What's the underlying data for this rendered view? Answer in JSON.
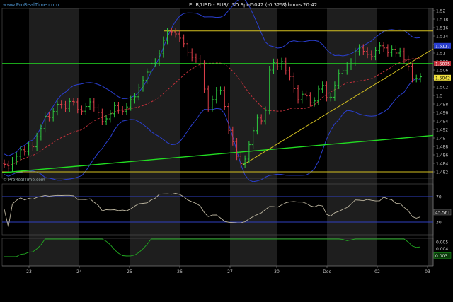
{
  "header": {
    "watermark": "www.ProRealTime.com",
    "title": "EUR/USD - EUR/USD Spot",
    "last": "1.5042 (-0.32%)",
    "period": "2 hours",
    "time": "20:42",
    "sub_watermark": "© ProRealTime.com"
  },
  "colors": {
    "background": "#000000",
    "shade": "#1e1e1e",
    "bullish": "#2ecc40",
    "bearish": "#e0404a",
    "bollinger": "#2a3fd0",
    "moving_average": "#c0303a",
    "support": "#22dd22",
    "trendline": "#d4c020",
    "rsi": "#bdb6a0",
    "momentum": "#22aa22",
    "levels": "#3040c0",
    "axis_text": "#c8c8c8"
  },
  "chart_data": [
    {
      "type": "candlestick",
      "title": "EUR/USD - EUR/USD Spot",
      "x_ticks": [
        "23",
        "24",
        "25",
        "26",
        "27",
        "30",
        "Dec",
        "02",
        "03"
      ],
      "y_ticks": [
        "1.482",
        "1.484",
        "1.486",
        "1.488",
        "1.49",
        "1.492",
        "1.494",
        "1.496",
        "1.498",
        "1.5",
        "1.502",
        "1.504",
        "1.506",
        "1.508",
        "1.51",
        "1.512",
        "1.514",
        "1.516",
        "1.518",
        "1.52"
      ],
      "ylim": [
        1.4805,
        1.5205
      ],
      "last_price_label": "1.5042",
      "right_labels": [
        "1.5117",
        "1.5075"
      ],
      "series_close": [
        1.4838,
        1.4829,
        1.4846,
        1.4857,
        1.4872,
        1.4868,
        1.4881,
        1.4879,
        1.4903,
        1.4922,
        1.4951,
        1.4948,
        1.4962,
        1.4979,
        1.4978,
        1.497,
        1.4986,
        1.4985,
        1.4967,
        1.4963,
        1.4974,
        1.4985,
        1.4971,
        1.496,
        1.4939,
        1.4945,
        1.4957,
        1.4976,
        1.4966,
        1.4963,
        1.4973,
        1.499,
        1.4997,
        1.5018,
        1.5036,
        1.5055,
        1.5076,
        1.5079,
        1.5098,
        1.513,
        1.5151,
        1.515,
        1.5145,
        1.5135,
        1.5122,
        1.5102,
        1.509,
        1.5086,
        1.5074,
        1.5015,
        1.4971,
        1.499,
        1.5011,
        1.5012,
        1.4974,
        1.4918,
        1.4891,
        1.4857,
        1.4839,
        1.485,
        1.4884,
        1.4917,
        1.4947,
        1.494,
        1.4965,
        1.506,
        1.5078,
        1.5069,
        1.508,
        1.5058,
        1.5045,
        1.5016,
        1.499,
        1.5003,
        1.4999,
        1.4983,
        1.4987,
        1.5015,
        1.5024,
        1.4995,
        1.4996,
        1.5024,
        1.5052,
        1.5058,
        1.5069,
        1.5079,
        1.5103,
        1.5112,
        1.5104,
        1.5097,
        1.5092,
        1.5106,
        1.5117,
        1.5112,
        1.5101,
        1.5109,
        1.51,
        1.5103,
        1.5085,
        1.5068,
        1.504,
        1.504,
        1.5044
      ],
      "series_open": [
        1.484,
        1.4838,
        1.4829,
        1.4846,
        1.4857,
        1.4872,
        1.4868,
        1.4881,
        1.4879,
        1.4903,
        1.4922,
        1.4951,
        1.4948,
        1.4962,
        1.4979,
        1.4978,
        1.497,
        1.4986,
        1.4985,
        1.4967,
        1.4963,
        1.4974,
        1.4985,
        1.4971,
        1.496,
        1.4939,
        1.4945,
        1.4957,
        1.4976,
        1.4966,
        1.4963,
        1.4973,
        1.499,
        1.4997,
        1.5018,
        1.5036,
        1.5055,
        1.5076,
        1.5079,
        1.5098,
        1.513,
        1.5151,
        1.515,
        1.5145,
        1.5135,
        1.5122,
        1.5102,
        1.509,
        1.5086,
        1.5074,
        1.5015,
        1.4971,
        1.499,
        1.5011,
        1.5012,
        1.4974,
        1.4918,
        1.4891,
        1.4857,
        1.4839,
        1.485,
        1.4884,
        1.4917,
        1.4947,
        1.494,
        1.4965,
        1.506,
        1.5078,
        1.5069,
        1.508,
        1.5058,
        1.5045,
        1.5016,
        1.499,
        1.5003,
        1.4999,
        1.4983,
        1.4987,
        1.5015,
        1.5024,
        1.4995,
        1.4996,
        1.5024,
        1.5052,
        1.5058,
        1.5069,
        1.5079,
        1.5103,
        1.5112,
        1.5104,
        1.5097,
        1.5092,
        1.5106,
        1.5117,
        1.5112,
        1.5101,
        1.5109,
        1.51,
        1.5103,
        1.5085,
        1.5068,
        1.504,
        1.504
      ],
      "annotations": {
        "horizontal_levels": [
          1.5152,
          1.482
        ],
        "support_level": 1.5075,
        "rising_support_from": 1.4818,
        "rising_support_to": 1.4906,
        "trendline_from": 1.4836,
        "trendline_to": 1.511
      }
    },
    {
      "type": "line",
      "title": "",
      "y_ticks": [
        "70",
        "30"
      ],
      "last_value_label": "45.561",
      "ylim": [
        10,
        90
      ]
    },
    {
      "type": "line",
      "title": "",
      "y_ticks": [
        "0.005",
        "0.004",
        "0.003"
      ],
      "last_value_label": "0.003",
      "ylim": [
        0.0015,
        0.0055
      ]
    }
  ]
}
